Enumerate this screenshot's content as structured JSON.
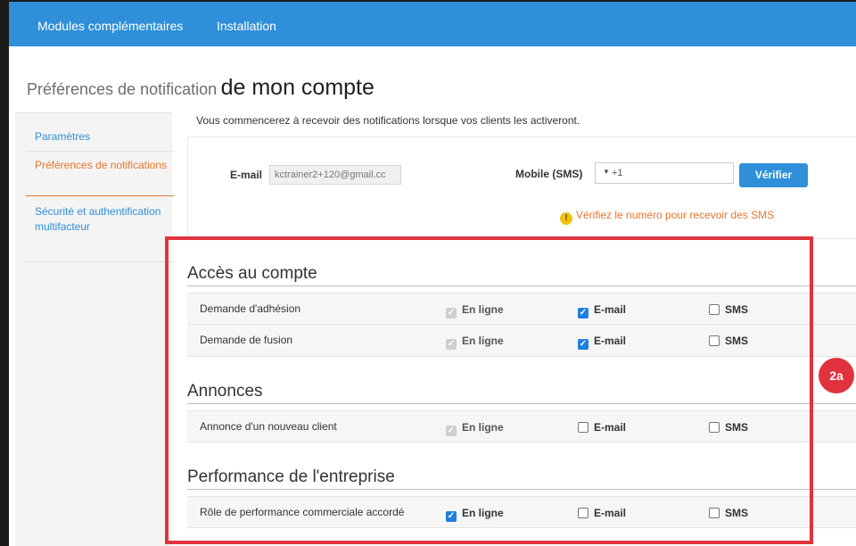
{
  "topbar": {
    "links": [
      "Modules complémentaires",
      "Installation"
    ]
  },
  "page": {
    "title_prefix": "Préférences de notification",
    "title_main": "de mon compte",
    "intro": "Vous commencerez à recevoir des notifications lorsque vos clients les activeront."
  },
  "sidebar": {
    "items": [
      {
        "label": "Paramètres",
        "active": false
      },
      {
        "label": "Préférences de notifications",
        "active": true
      },
      {
        "label": "Sécurité et authentification multifacteur",
        "active": false
      }
    ]
  },
  "contact": {
    "email_label": "E-mail",
    "email_value": "kctrainer2+120@gmail.cc",
    "mobile_label": "Mobile (SMS)",
    "mobile_prefix": "+1",
    "verify_label": "Vérifier",
    "warning_text": "Vérifiez le numéro pour recevoir des SMS"
  },
  "channels": {
    "online": "En ligne",
    "email": "E-mail",
    "sms": "SMS"
  },
  "sections": [
    {
      "title": "Accès au compte",
      "rows": [
        {
          "label": "Demande d'adhésion",
          "online": "checked-disabled",
          "email": "checked",
          "sms": "unchecked"
        },
        {
          "label": "Demande de fusion",
          "online": "checked-disabled",
          "email": "checked",
          "sms": "unchecked"
        }
      ]
    },
    {
      "title": "Annonces",
      "rows": [
        {
          "label": "Annonce d'un nouveau client",
          "online": "checked-disabled",
          "email": "unchecked",
          "sms": "unchecked"
        }
      ]
    },
    {
      "title": "Performance de l'entreprise",
      "rows": [
        {
          "label": "Rôle de performance commerciale accordé",
          "online": "checked",
          "email": "unchecked",
          "sms": "unchecked"
        }
      ]
    }
  ],
  "annotation": {
    "callout": "2a",
    "color": "#e0333d"
  },
  "colors": {
    "brand_blue": "#2f8fd8",
    "active_orange": "#e8762c",
    "checkbox_blue": "#1f7fe0"
  }
}
